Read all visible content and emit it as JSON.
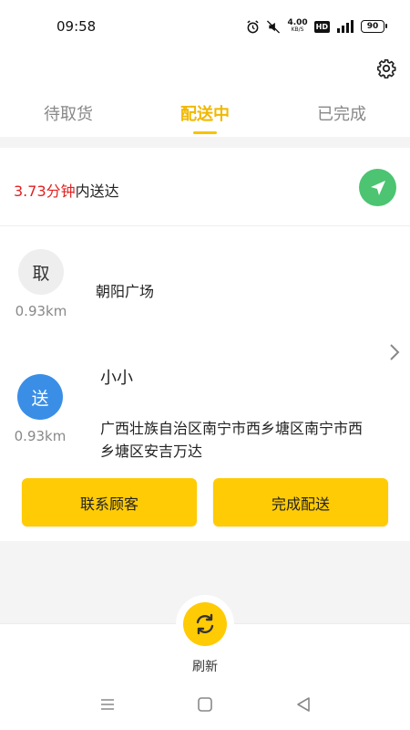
{
  "status_bar": {
    "time": "09:58",
    "net_speed_value": "4.00",
    "net_speed_unit": "KB/S",
    "hd_label": "HD",
    "battery": "90",
    "icons": [
      "alarm-icon",
      "mute-icon",
      "signal-icon",
      "battery-icon"
    ]
  },
  "tabs": [
    {
      "label": "待取货",
      "active": false
    },
    {
      "label": "配送中",
      "active": true
    },
    {
      "label": "已完成",
      "active": false
    }
  ],
  "order": {
    "eta_value": "3.73分钟",
    "eta_suffix": "内送达",
    "pickup": {
      "badge": "取",
      "distance": "0.93km",
      "name": "朝阳广场"
    },
    "delivery": {
      "badge": "送",
      "distance": "0.93km",
      "customer": "小小",
      "address": "广西壮族自治区南宁市西乡塘区南宁市西乡塘区安吉万达"
    },
    "buttons": {
      "contact": "联系顾客",
      "complete": "完成配送"
    }
  },
  "bottom": {
    "refresh_label": "刷新"
  },
  "colors": {
    "accent": "#ffcb05",
    "active_tab": "#f0b800",
    "eta_red": "#e02020",
    "nav_green": "#4cc471",
    "send_blue": "#3a8ee6"
  }
}
